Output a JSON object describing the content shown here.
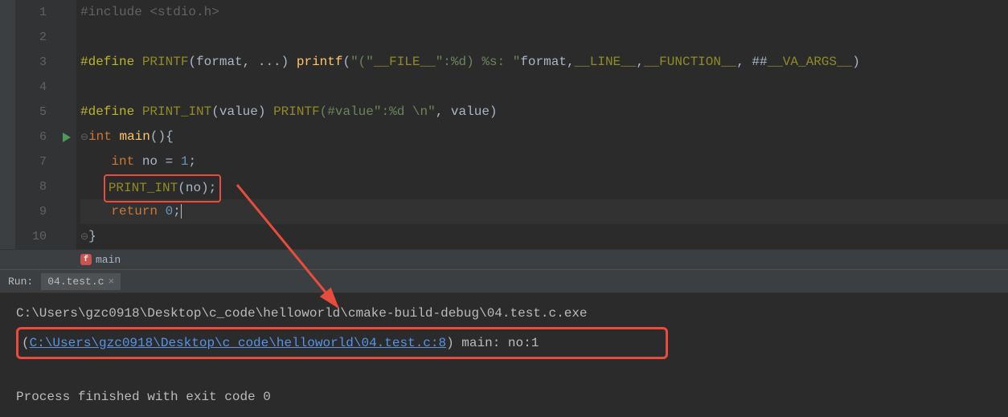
{
  "code": {
    "lines": [
      {
        "n": "1"
      },
      {
        "n": "2"
      },
      {
        "n": "3"
      },
      {
        "n": "4"
      },
      {
        "n": "5"
      },
      {
        "n": "6"
      },
      {
        "n": "7"
      },
      {
        "n": "8"
      },
      {
        "n": "9"
      },
      {
        "n": "10"
      }
    ],
    "line1_define": "#include",
    "line1_path": "<stdio.h>",
    "line3_define": "#define",
    "line3_macro": "PRINTF",
    "line3_args": "(format, ...) ",
    "line3_fn": "printf",
    "line3_str1": "\"(\"",
    "line3_file": "__FILE__",
    "line3_str2": "\":%d) %s: \"",
    "line3_fmt": "format,",
    "line3_line": "__LINE__",
    "line3_comma": ",",
    "line3_func": "__FUNCTION__",
    "line3_end": ", ##",
    "line3_va": "__VA_ARGS__",
    "line3_paren": ")",
    "line5_define": "#define",
    "line5_macro": "PRINT_INT",
    "line5_args": "(value) ",
    "line5_call": "PRINTF",
    "line5_str": "(#value\":%d \\n\"",
    "line5_end": ", value)",
    "line6_int": "int",
    "line6_main": " main",
    "line6_brace": "(){",
    "line7_int": "int",
    "line7_rest": " no = ",
    "line7_num": "1",
    "line7_semi": ";",
    "line8_call": "PRINT_INT",
    "line8_arg": "(no);",
    "line9_return": "return",
    "line9_num": " 0",
    "line9_semi": ";",
    "line10_brace": "}"
  },
  "breadcrumb": {
    "fn_icon": "f",
    "fn_name": "main"
  },
  "run": {
    "label": "Run:",
    "tab_name": "04.test.c",
    "tab_close": "×"
  },
  "console": {
    "line1": "C:\\Users\\gzc0918\\Desktop\\c_code\\helloworld\\cmake-build-debug\\04.test.c.exe",
    "line2_open": "(",
    "line2_link": "C:\\Users\\gzc0918\\Desktop\\c_code\\helloworld\\04.test.c:8",
    "line2_rest": ") main: no:1",
    "line3": "",
    "line4": "Process finished with exit code 0"
  }
}
